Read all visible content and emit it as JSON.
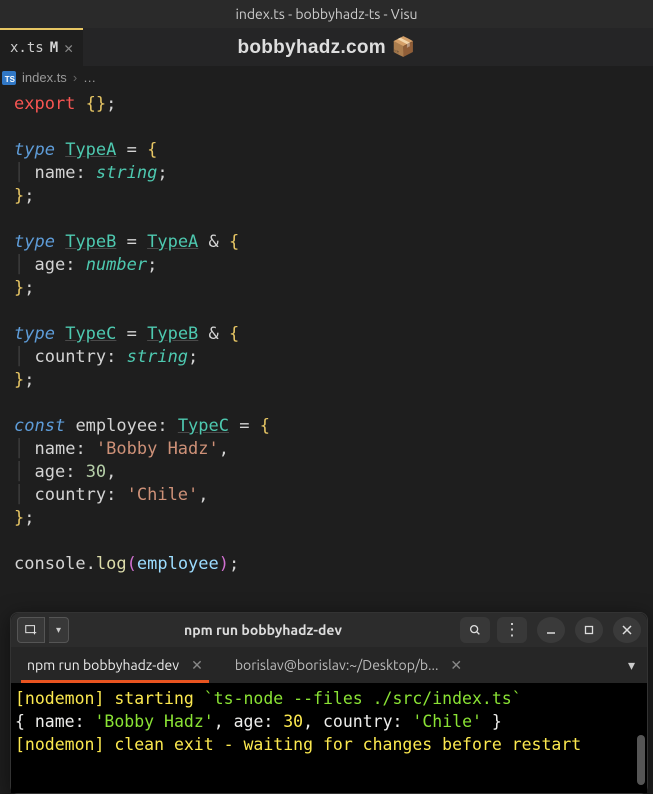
{
  "window": {
    "title": "index.ts - bobbyhadz-ts - Visu"
  },
  "tab": {
    "label": "x.ts",
    "modified_indicator": "M",
    "close_glyph": "✕"
  },
  "watermark": "bobbyhadz.com 📦",
  "breadcrumb": {
    "file_icon_text": "TS",
    "file": "index.ts",
    "separator": "›",
    "more": "…"
  },
  "code": {
    "export_kw": "export",
    "type_kw": "type",
    "const_kw": "const",
    "typeA": "TypeA",
    "typeB": "TypeB",
    "typeC": "TypeC",
    "name_prop": "name",
    "age_prop": "age",
    "country_prop": "country",
    "string_t": "string",
    "number_t": "number",
    "employee_var": "employee",
    "name_val": "'Bobby Hadz'",
    "age_val": "30",
    "country_val": "'Chile'",
    "console_obj": "console",
    "log_fn": "log"
  },
  "terminal": {
    "header_title": "npm run bobbyhadz-dev",
    "tabs": [
      {
        "label": "npm run bobbyhadz-dev",
        "active": true
      },
      {
        "label": "borislav@borislav:~/Desktop/b...",
        "active": false
      }
    ],
    "lines": {
      "l1_a": "[nodemon]",
      "l1_b": " starting ",
      "l1_c": "`ts-node --files ./src/index.ts`",
      "l2": "{ name: ",
      "l2_name": "'Bobby Hadz'",
      "l2_mid": ", age: ",
      "l2_age": "30",
      "l2_mid2": ", country: ",
      "l2_country": "'Chile'",
      "l2_end": " }",
      "l3": "[nodemon] clean exit - waiting for changes before restart"
    }
  }
}
